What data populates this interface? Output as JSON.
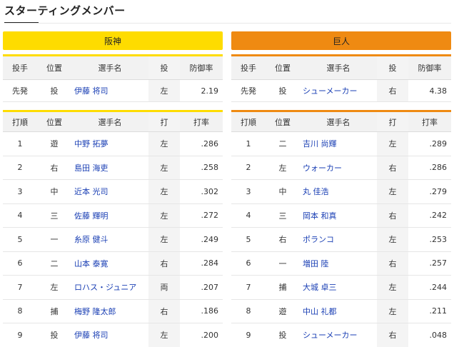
{
  "page": {
    "title": "スターティングメンバー"
  },
  "home": {
    "team_name": "阪神",
    "pitcher_headers": [
      "投手",
      "位置",
      "選手名",
      "投",
      "防御率"
    ],
    "pitcher": {
      "role": "先発",
      "pos": "投",
      "name": "伊藤 将司",
      "hand": "左",
      "stat": "2.19"
    },
    "order_headers": [
      "打順",
      "位置",
      "選手名",
      "打",
      "打率"
    ],
    "order": [
      {
        "num": "1",
        "pos": "遊",
        "name": "中野 拓夢",
        "hand": "左",
        "avg": ".286"
      },
      {
        "num": "2",
        "pos": "右",
        "name": "島田 海吏",
        "hand": "左",
        "avg": ".258"
      },
      {
        "num": "3",
        "pos": "中",
        "name": "近本 光司",
        "hand": "左",
        "avg": ".302"
      },
      {
        "num": "4",
        "pos": "三",
        "name": "佐藤 輝明",
        "hand": "左",
        "avg": ".272"
      },
      {
        "num": "5",
        "pos": "一",
        "name": "糸原 健斗",
        "hand": "左",
        "avg": ".249"
      },
      {
        "num": "6",
        "pos": "二",
        "name": "山本 泰寛",
        "hand": "右",
        "avg": ".284"
      },
      {
        "num": "7",
        "pos": "左",
        "name": "ロハス・ジュニア",
        "hand": "両",
        "avg": ".207"
      },
      {
        "num": "8",
        "pos": "捕",
        "name": "梅野 隆太郎",
        "hand": "右",
        "avg": ".186"
      },
      {
        "num": "9",
        "pos": "投",
        "name": "伊藤 将司",
        "hand": "左",
        "avg": ".200"
      }
    ]
  },
  "away": {
    "team_name": "巨人",
    "pitcher_headers": [
      "投手",
      "位置",
      "選手名",
      "投",
      "防御率"
    ],
    "pitcher": {
      "role": "先発",
      "pos": "投",
      "name": "シューメーカー",
      "hand": "右",
      "stat": "4.38"
    },
    "order_headers": [
      "打順",
      "位置",
      "選手名",
      "打",
      "打率"
    ],
    "order": [
      {
        "num": "1",
        "pos": "二",
        "name": "吉川 尚輝",
        "hand": "左",
        "avg": ".289"
      },
      {
        "num": "2",
        "pos": "左",
        "name": "ウォーカー",
        "hand": "右",
        "avg": ".286"
      },
      {
        "num": "3",
        "pos": "中",
        "name": "丸 佳浩",
        "hand": "左",
        "avg": ".279"
      },
      {
        "num": "4",
        "pos": "三",
        "name": "岡本 和真",
        "hand": "右",
        "avg": ".242"
      },
      {
        "num": "5",
        "pos": "右",
        "name": "ポランコ",
        "hand": "左",
        "avg": ".253"
      },
      {
        "num": "6",
        "pos": "一",
        "name": "増田 陸",
        "hand": "右",
        "avg": ".257"
      },
      {
        "num": "7",
        "pos": "捕",
        "name": "大城 卓三",
        "hand": "左",
        "avg": ".244"
      },
      {
        "num": "8",
        "pos": "遊",
        "name": "中山 礼都",
        "hand": "左",
        "avg": ".211"
      },
      {
        "num": "9",
        "pos": "投",
        "name": "シューメーカー",
        "hand": "右",
        "avg": ".048"
      }
    ]
  },
  "colors": {
    "home_accent": "#fedc00",
    "away_accent": "#ef8a12",
    "link": "#1a3fb4"
  }
}
